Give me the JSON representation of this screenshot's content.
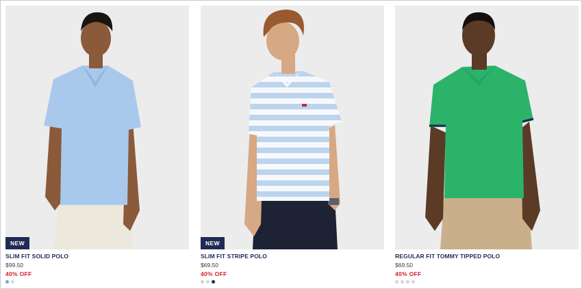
{
  "products": [
    {
      "name": "SLIM FIT SOLID POLO",
      "price": "$99.50",
      "discount": "40% OFF",
      "badge": "NEW",
      "shirt_color": "#a9c9ec",
      "swatches": [
        "#7d9fc9",
        "#d9d9d9"
      ]
    },
    {
      "name": "SLIM FIT STRIPE POLO",
      "price": "$69.50",
      "discount": "40% OFF",
      "badge": "NEW",
      "shirt_color": "#f6f8fb",
      "swatches": [
        "#e8c9cc",
        "#c9d9e8",
        "#1f2a55"
      ]
    },
    {
      "name": "REGULAR FIT TOMMY TIPPED POLO",
      "price": "$69.50",
      "discount": "40% OFF",
      "badge": "",
      "shirt_color": "#2bb36a",
      "swatches": [
        "#d6d6d6",
        "#d6d6d6",
        "#d6d6d6",
        "#d6d6d6"
      ]
    }
  ],
  "colors": {
    "brand_navy": "#1f2a55",
    "sale_red": "#d11f2e",
    "photo_bg": "#ececec"
  }
}
